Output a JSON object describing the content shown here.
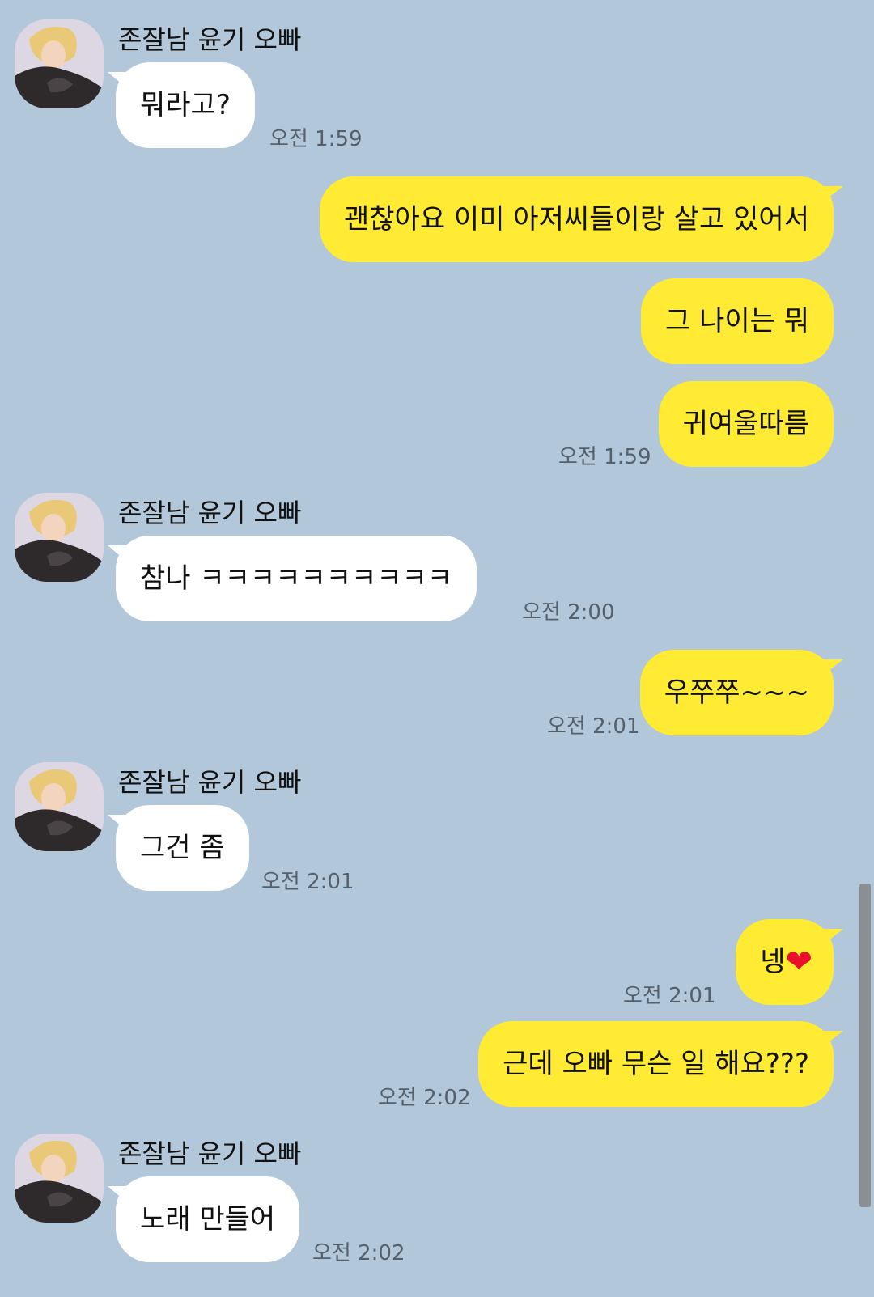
{
  "sender": {
    "name": "존잘남 윤기 오빠"
  },
  "messages": [
    {
      "text": "뭐라고?",
      "time": "오전 1:59"
    },
    {
      "text": "괜찮아요 이미 아저씨들이랑 살고 있어서"
    },
    {
      "text": "그 나이는 뭐"
    },
    {
      "text": "귀여울따름",
      "time": "오전 1:59"
    },
    {
      "text": "참나 ㅋㅋㅋㅋㅋㅋㅋㅋㅋㅋ",
      "time": "오전 2:00"
    },
    {
      "text": "우쭈쭈~~~",
      "time": "오전 2:01"
    },
    {
      "text": "그건 좀",
      "time": "오전 2:01"
    },
    {
      "text": "넹",
      "emoji": "❤",
      "emoji_name": "red-heart",
      "time": "오전 2:01"
    },
    {
      "text": "근데 오빠 무슨 일 해요???",
      "time": "오전 2:02"
    },
    {
      "text": "노래 만들어",
      "time": "오전 2:02"
    }
  ],
  "colors": {
    "background": "#b2c7da",
    "incoming_bubble": "#ffffff",
    "outgoing_bubble": "#ffeb33",
    "timestamp": "#55606b"
  }
}
